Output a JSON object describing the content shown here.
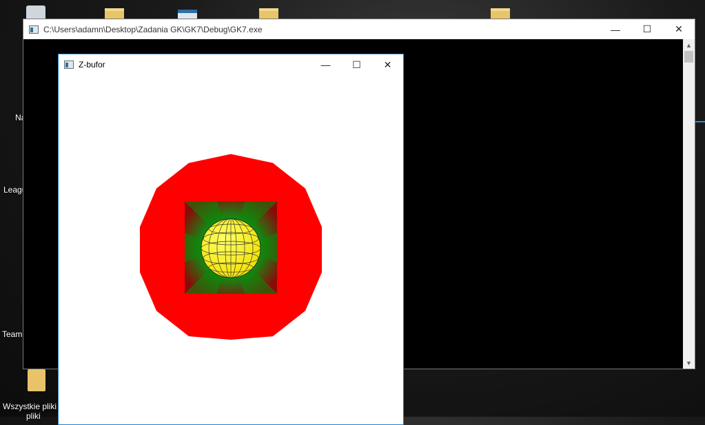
{
  "desktop": {
    "labels": [
      "Na",
      "Leagu",
      "Team",
      "Wszystkie pliki",
      "pliki"
    ],
    "icons": [
      "recycle-bin-icon",
      "folder-icon",
      "window-icon",
      "folder-icon",
      "folder-icon",
      "file-icon"
    ]
  },
  "console_window": {
    "title": "C:\\Users\\adamn\\Desktop\\Zadania GK\\GK7\\Debug\\GK7.exe",
    "minimize": "—",
    "maximize": "☐",
    "close": "✕",
    "scroll_up": "▲",
    "scroll_down": "▼"
  },
  "zbuffer_window": {
    "title": "Z-bufor",
    "minimize": "—",
    "maximize": "☐",
    "close": "✕"
  },
  "colors": {
    "polygon": "#ff0000",
    "square_center": "#006400",
    "sphere": "#ffff00",
    "accent": "#1e7fc9"
  }
}
